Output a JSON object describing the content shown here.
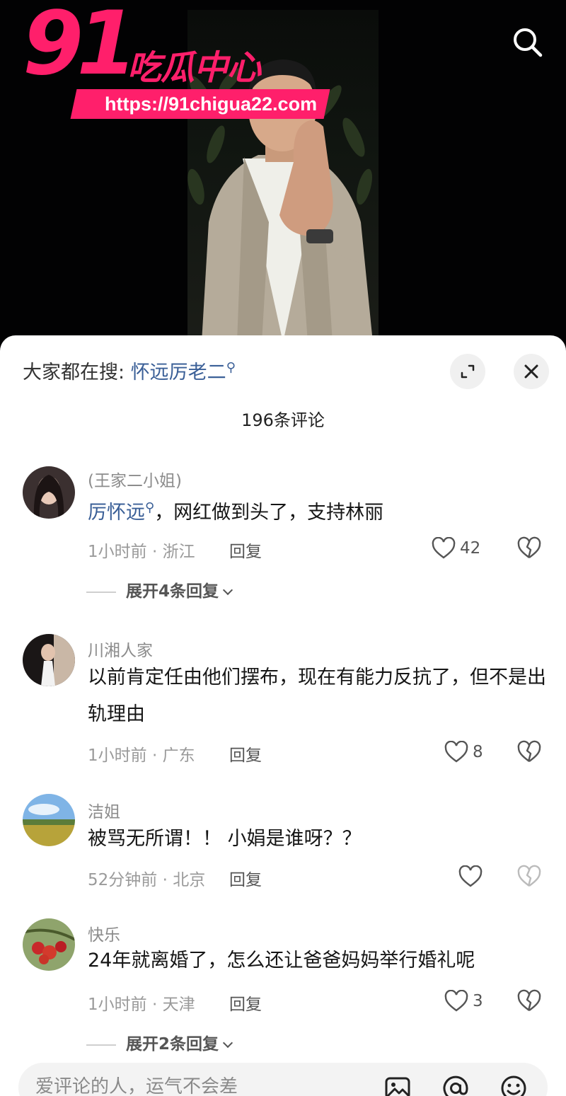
{
  "brand": {
    "number": "91",
    "name": "吃瓜中心",
    "url": "https://91chigua22.com",
    "color": "#ff1f6b"
  },
  "header": {
    "search_icon": "search-icon"
  },
  "sheet": {
    "trend_prefix": "大家都在搜: ",
    "trend_keyword": "怀远厉老二",
    "comment_count": "196条评论",
    "keyword_color": "#3a5f97"
  },
  "comments": [
    {
      "username": "(王家二小姐)",
      "text_keyword": "厉怀远",
      "text_rest": "，网红做到头了，支持林丽",
      "meta": "1小时前 · 浙江",
      "reply_label": "回复",
      "likes": "42",
      "expand_label": "展开4条回复"
    },
    {
      "username": "川湘人家",
      "text": "以前肯定任由他们摆布，现在有能力反抗了，但不是出轨理由",
      "meta": "1小时前 · 广东",
      "reply_label": "回复",
      "likes": "8"
    },
    {
      "username": "洁姐",
      "text": "被骂无所谓！！ 小娟是谁呀？？",
      "meta": "52分钟前 · 北京",
      "reply_label": "回复"
    },
    {
      "username": "快乐",
      "text": "24年就离婚了，怎么还让爸爸妈妈举行婚礼呢",
      "meta": "1小时前 · 天津",
      "reply_label": "回复",
      "likes": "3",
      "expand_label": "展开2条回复"
    }
  ],
  "input": {
    "placeholder": "爱评论的人，运气不会差"
  }
}
